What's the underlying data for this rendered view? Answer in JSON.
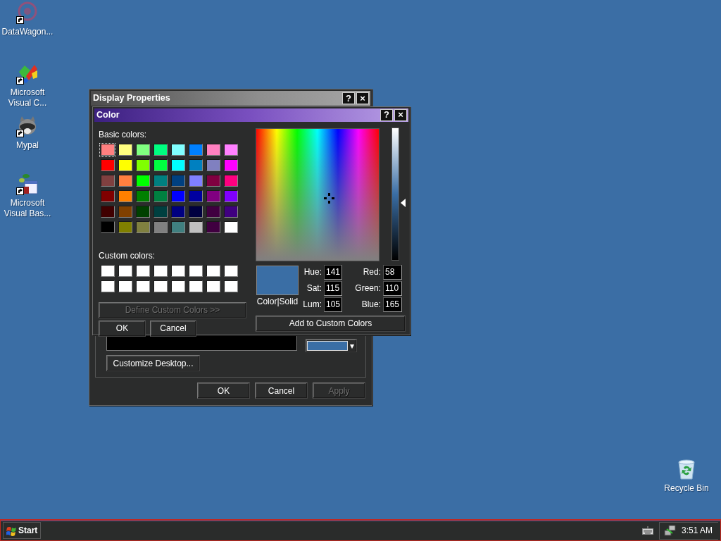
{
  "desktop_icons": [
    {
      "label": "DataWagon...",
      "shortcut": true
    },
    {
      "label": "Microsoft Visual C...",
      "shortcut": true
    },
    {
      "label": "Mypal",
      "shortcut": true
    },
    {
      "label": "Microsoft Visual Bas...",
      "shortcut": true
    }
  ],
  "recycle_bin": {
    "label": "Recycle Bin"
  },
  "display_properties": {
    "title": "Display Properties",
    "title_buttons": [
      "?",
      "×"
    ],
    "background_field": {
      "color": "#000000"
    },
    "color_button": {
      "color": "#3a6ea5",
      "caret": "▾"
    },
    "customize_button": {
      "label": "Customize Desktop...",
      "disabled": false
    },
    "buttons": [
      {
        "label": "OK",
        "disabled": false
      },
      {
        "label": "Cancel",
        "disabled": false
      },
      {
        "label": "Apply",
        "disabled": true
      }
    ]
  },
  "color_dialog": {
    "title": "Color",
    "title_buttons": [
      "?",
      "×"
    ],
    "basic_colors_label": "Basic colors:",
    "basic_colors": [
      {
        "color": "#ff8080",
        "selected": true
      },
      {
        "color": "#ffff80",
        "selected": false
      },
      {
        "color": "#80ff80",
        "selected": false
      },
      {
        "color": "#00ff80",
        "selected": false
      },
      {
        "color": "#80ffff",
        "selected": false
      },
      {
        "color": "#0080ff",
        "selected": false
      },
      {
        "color": "#ff80c0",
        "selected": false
      },
      {
        "color": "#ff80ff",
        "selected": false
      },
      {
        "color": "#ff0000",
        "selected": false
      },
      {
        "color": "#ffff00",
        "selected": false
      },
      {
        "color": "#80ff00",
        "selected": false
      },
      {
        "color": "#00ff40",
        "selected": false
      },
      {
        "color": "#00ffff",
        "selected": false
      },
      {
        "color": "#0080c0",
        "selected": false
      },
      {
        "color": "#8080c0",
        "selected": false
      },
      {
        "color": "#ff00ff",
        "selected": false
      },
      {
        "color": "#804040",
        "selected": false
      },
      {
        "color": "#ff8040",
        "selected": false
      },
      {
        "color": "#00ff00",
        "selected": false
      },
      {
        "color": "#008080",
        "selected": false
      },
      {
        "color": "#004080",
        "selected": false
      },
      {
        "color": "#8080ff",
        "selected": false
      },
      {
        "color": "#800040",
        "selected": false
      },
      {
        "color": "#ff0080",
        "selected": false
      },
      {
        "color": "#800000",
        "selected": false
      },
      {
        "color": "#ff8000",
        "selected": false
      },
      {
        "color": "#008000",
        "selected": false
      },
      {
        "color": "#008040",
        "selected": false
      },
      {
        "color": "#0000ff",
        "selected": false
      },
      {
        "color": "#0000a0",
        "selected": false
      },
      {
        "color": "#800080",
        "selected": false
      },
      {
        "color": "#8000ff",
        "selected": false
      },
      {
        "color": "#400000",
        "selected": false
      },
      {
        "color": "#804000",
        "selected": false
      },
      {
        "color": "#004000",
        "selected": false
      },
      {
        "color": "#004040",
        "selected": false
      },
      {
        "color": "#000080",
        "selected": false
      },
      {
        "color": "#000040",
        "selected": false
      },
      {
        "color": "#400040",
        "selected": false
      },
      {
        "color": "#400080",
        "selected": false
      },
      {
        "color": "#000000",
        "selected": false
      },
      {
        "color": "#808000",
        "selected": false
      },
      {
        "color": "#808040",
        "selected": false
      },
      {
        "color": "#808080",
        "selected": false
      },
      {
        "color": "#408080",
        "selected": false
      },
      {
        "color": "#c0c0c0",
        "selected": false
      },
      {
        "color": "#400040",
        "selected": false
      },
      {
        "color": "#ffffff",
        "selected": false
      }
    ],
    "custom_colors_label": "Custom colors:",
    "custom_colors": [
      {
        "color": "#ffffff"
      },
      {
        "color": "#ffffff"
      },
      {
        "color": "#ffffff"
      },
      {
        "color": "#ffffff"
      },
      {
        "color": "#ffffff"
      },
      {
        "color": "#ffffff"
      },
      {
        "color": "#ffffff"
      },
      {
        "color": "#ffffff"
      },
      {
        "color": "#ffffff"
      },
      {
        "color": "#ffffff"
      },
      {
        "color": "#ffffff"
      },
      {
        "color": "#ffffff"
      },
      {
        "color": "#ffffff"
      },
      {
        "color": "#ffffff"
      },
      {
        "color": "#ffffff"
      },
      {
        "color": "#ffffff"
      }
    ],
    "define_button": {
      "label": "Define Custom Colors >>",
      "disabled": true
    },
    "buttons": [
      {
        "label": "OK",
        "disabled": false
      },
      {
        "label": "Cancel",
        "disabled": false
      }
    ],
    "preview": {
      "color": "#3a6ea5",
      "label": "Color|Solid"
    },
    "luminance": {
      "level": 0.4375
    },
    "fields": [
      {
        "label": "Hue:",
        "value": "141"
      },
      {
        "label": "Red:",
        "value": "58"
      },
      {
        "label": "Sat:",
        "value": "115"
      },
      {
        "label": "Green:",
        "value": "110"
      },
      {
        "label": "Lum:",
        "value": "105"
      },
      {
        "label": "Blue:",
        "value": "165"
      }
    ],
    "add_button": {
      "label": "Add to Custom Colors",
      "disabled": false
    }
  },
  "taskbar": {
    "start_label": "Start",
    "clock": "3:51 AM"
  }
}
